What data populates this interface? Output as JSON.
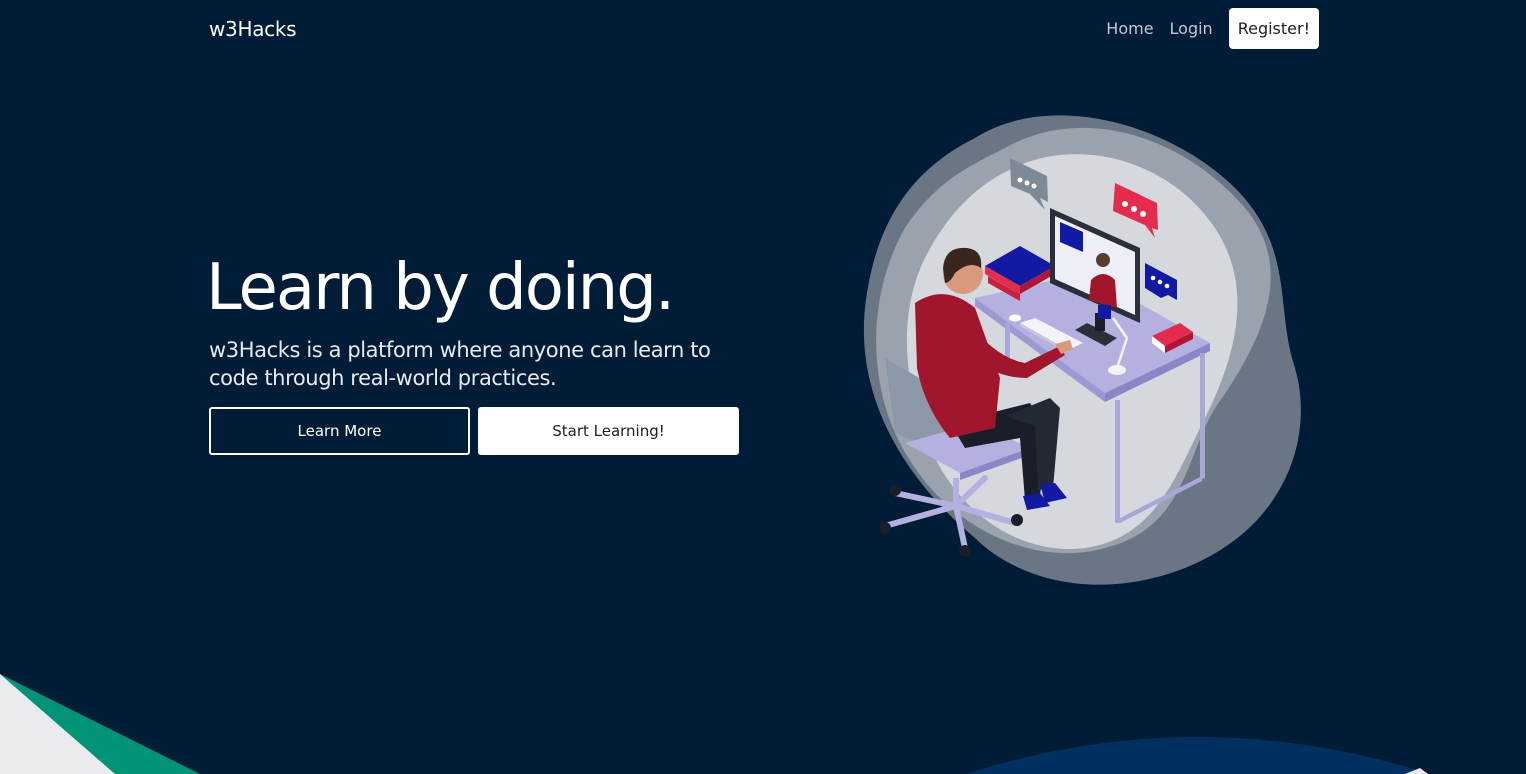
{
  "nav": {
    "brand": "w3Hacks",
    "links": [
      {
        "label": "Home"
      },
      {
        "label": "Login"
      }
    ],
    "register_label": "Register!"
  },
  "hero": {
    "headline": "Learn by doing.",
    "tagline": "w3Hacks is a platform where anyone can learn to code through real-world practices.",
    "learn_more_label": "Learn More",
    "start_label": "Start Learning!"
  },
  "illustration": {
    "icon": "person-at-computer-illustration"
  },
  "colors": {
    "background": "#011c36",
    "accent_green": "#009477",
    "accent_blue": "#00305f",
    "chat_red": "#e52c4c",
    "chat_blue": "#1219a3",
    "shirt_red": "#a1162c",
    "desk_lavender": "#b4b1e0"
  }
}
